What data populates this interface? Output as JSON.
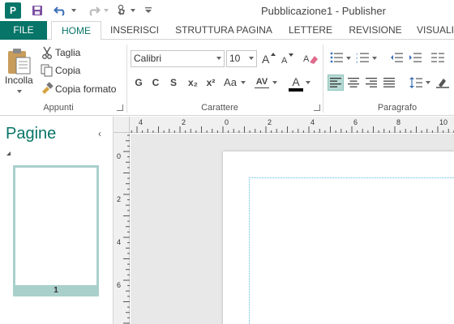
{
  "app": {
    "icon_letter": "P",
    "window_title": "Pubblicazione1 - Publisher"
  },
  "quick_access": {
    "icons": [
      "save-icon",
      "undo-icon",
      "redo-icon",
      "touch-mode-icon",
      "customize-icon"
    ]
  },
  "tabs": [
    {
      "label": "FILE"
    },
    {
      "label": "HOME"
    },
    {
      "label": "INSERISCI"
    },
    {
      "label": "STRUTTURA PAGINA"
    },
    {
      "label": "LETTERE"
    },
    {
      "label": "REVISIONE"
    },
    {
      "label": "VISUALI"
    }
  ],
  "ribbon": {
    "clipboard": {
      "paste_label": "Incolla",
      "cut_label": "Taglia",
      "copy_label": "Copia",
      "format_painter_label": "Copia formato",
      "group_label": "Appunti"
    },
    "font": {
      "font_name": "Calibri",
      "font_size": "10",
      "bold": "G",
      "italic": "C",
      "underline": "S",
      "subscript": "x₂",
      "superscript": "x²",
      "change_case": "Aa",
      "char_spacing": "AV",
      "font_color": "A",
      "group_label": "Carattere"
    },
    "paragraph": {
      "group_label": "Paragrafo"
    }
  },
  "pages_pane": {
    "title": "Pagine",
    "page_number": "1"
  },
  "ruler": {
    "horizontal_labels": [
      "4",
      "2",
      "0",
      "2",
      "4",
      "6",
      "8",
      "10"
    ],
    "vertical_labels": [
      "0",
      "2",
      "4",
      "6"
    ]
  },
  "colors": {
    "accent": "#077568",
    "selection": "#a9d0cb",
    "font_color_bar": "#000000"
  }
}
